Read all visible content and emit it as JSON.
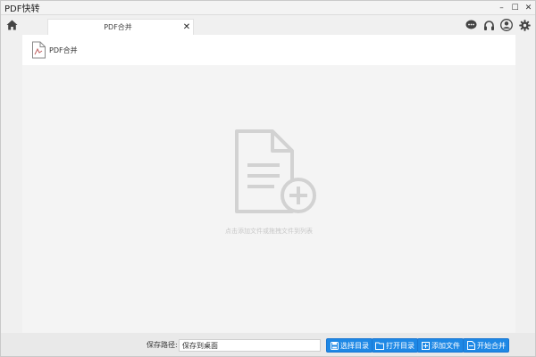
{
  "app": {
    "title": "PDF快转"
  },
  "window_controls": {
    "minimize": "–",
    "maximize": "☐",
    "close": "✕"
  },
  "tabs": [
    {
      "label": "PDF合并",
      "close": "✕"
    }
  ],
  "header_icons": [
    "chat-icon",
    "headset-icon",
    "user-icon",
    "gear-icon"
  ],
  "toolbar": {
    "items": [
      {
        "label": "PDF合并",
        "icon": "pdf-merge-icon"
      }
    ]
  },
  "content": {
    "empty_hint": "点击添加文件或拖拽文件到列表"
  },
  "bottom": {
    "path_label": "保存路径:",
    "path_value": "保存到桌面",
    "buttons": [
      {
        "label": "选择目录",
        "icon": "save-icon"
      },
      {
        "label": "打开目录",
        "icon": "folder-icon"
      },
      {
        "label": "添加文件",
        "icon": "plus-icon"
      },
      {
        "label": "开始合并",
        "icon": "file-icon"
      }
    ]
  },
  "colors": {
    "accent": "#1e88e5",
    "content_bg": "#f4f4f4",
    "icon_gray": "#cfcfcf"
  }
}
